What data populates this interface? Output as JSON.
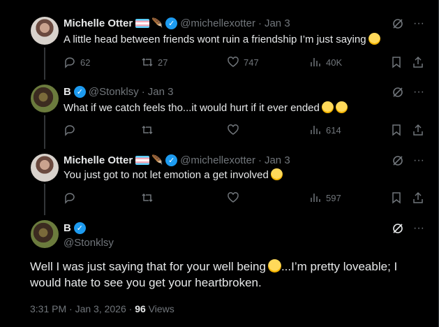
{
  "posts": [
    {
      "name": "Michelle Otter",
      "handle": "@michellexotter",
      "date": "Jan 3",
      "text": "A little head between friends wont ruin a friendship I’m just saying",
      "replies": "62",
      "reposts": "27",
      "likes": "747",
      "views": "40K"
    },
    {
      "name": "B",
      "handle": "@Stonklsy",
      "date": "Jan 3",
      "text": "What if we catch feels tho...it would hurt if it ever ended",
      "replies": "",
      "reposts": "",
      "likes": "",
      "views": "614"
    },
    {
      "name": "Michelle Otter",
      "handle": "@michellexotter",
      "date": "Jan 3",
      "text": "You just got to not let emotion a get involved",
      "replies": "",
      "reposts": "",
      "likes": "",
      "views": "597"
    }
  ],
  "main_post": {
    "name": "B",
    "handle": "@Stonklsy",
    "text_part1": "Well I was just saying that for your well being",
    "text_part2": "...I’m pretty loveable; I would hate to see you get your heartbroken.",
    "time": "3:31 PM · Jan 3, 2026 · ",
    "views_count": "96",
    "views_label": " Views"
  },
  "separator": "·",
  "verified_check": "✓",
  "more_glyph": "···",
  "icons": [
    "reply-icon",
    "repost-icon",
    "like-icon",
    "views-icon",
    "bookmark-icon",
    "share-icon",
    "grok-icon",
    "more-icon"
  ]
}
